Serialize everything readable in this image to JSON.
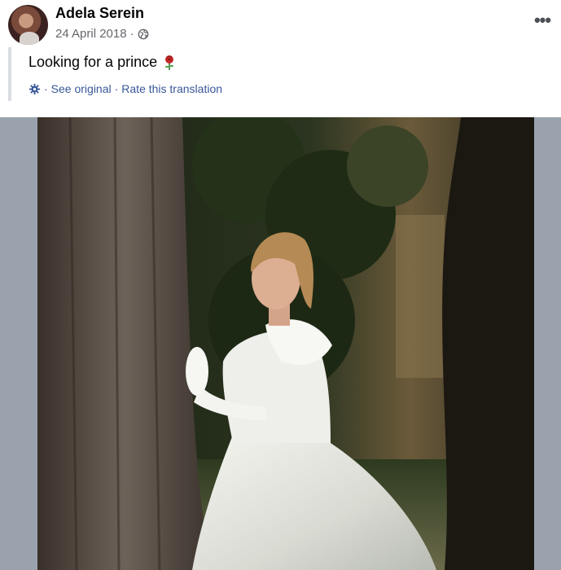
{
  "post": {
    "author": "Adela Serein",
    "date": "24 April 2018",
    "separator": "·",
    "audience_icon": "globe-icon",
    "more_icon": "more-options-icon",
    "text": "Looking for a prince",
    "emoji": "rose-icon"
  },
  "translation": {
    "icon": "translate-gear-icon",
    "separator1": "·",
    "see_original": "See original",
    "separator2": "·",
    "rate": "Rate this translation"
  },
  "colors": {
    "link": "#385898",
    "meta": "#65676b",
    "frame": "#9aa2ae"
  }
}
